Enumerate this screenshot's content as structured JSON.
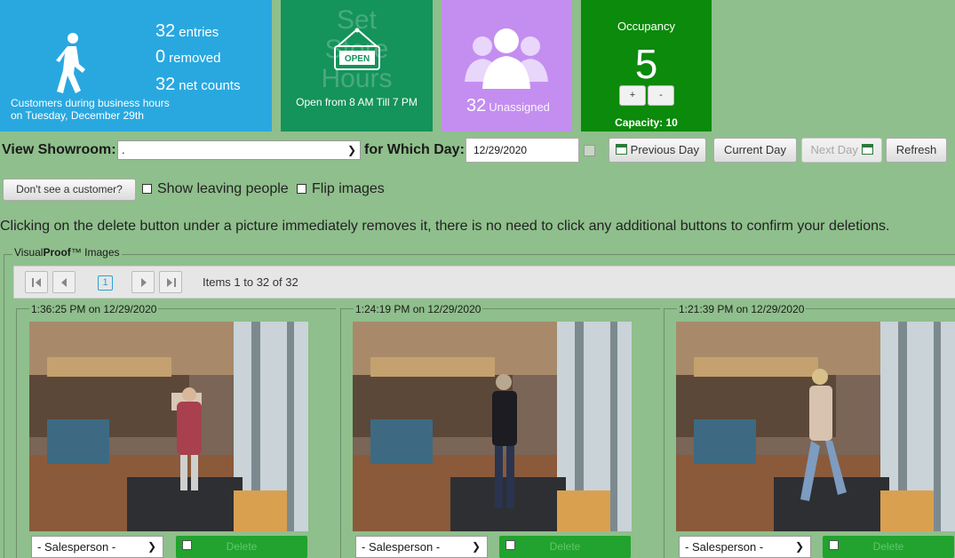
{
  "tiles": {
    "customers": {
      "entries_value": "32",
      "entries_label": "entries",
      "removed_value": "0",
      "removed_label": "removed",
      "net_value": "32",
      "net_label": "net counts",
      "caption_line1": "Customers during business hours",
      "caption_line2": "on Tuesday, December 29th"
    },
    "hours": {
      "ghost_line1": "Set",
      "ghost_line2": "Store",
      "ghost_line3": "Hours",
      "sign_text": "OPEN",
      "caption": "Open from 8 AM Till 7 PM"
    },
    "unassigned": {
      "value": "32",
      "label": "Unassigned"
    },
    "occupancy": {
      "title": "Occupancy",
      "value": "5",
      "plus_label": "+",
      "minus_label": "-",
      "capacity": "Capacity: 10"
    }
  },
  "controls": {
    "showroom_label": "View Showroom:",
    "showroom_value": ".",
    "day_label": "for Which Day:",
    "date_value": "12/29/2020",
    "prev_day": "Previous Day",
    "current_day": "Current Day",
    "next_day": "Next Day",
    "refresh": "Refresh",
    "dont_see": "Don't see a customer?",
    "show_leaving": "Show leaving people",
    "flip_images": "Flip images"
  },
  "notice": "Clicking on the delete button under a picture immediately removes it, there is no need to click any additional buttons to confirm your deletions.",
  "visualproof": {
    "legend_prefix": "Visual",
    "legend_bold": "Proof",
    "legend_suffix": "™ Images",
    "page_number": "1",
    "items_info": "Items 1 to 32 of 32"
  },
  "cards": [
    {
      "timestamp": "1:36:25 PM on 12/29/2020",
      "salesperson": "- Salesperson -",
      "delete_label": "Delete"
    },
    {
      "timestamp": "1:24:19 PM on 12/29/2020",
      "salesperson": "- Salesperson -",
      "delete_label": "Delete"
    },
    {
      "timestamp": "1:21:39 PM on 12/29/2020",
      "salesperson": "- Salesperson -",
      "delete_label": "Delete"
    }
  ],
  "colors": {
    "page_bg": "#8fbf8c",
    "tile_blue": "#29a8e0",
    "tile_green": "#14935a",
    "tile_purple": "#c48ef0",
    "tile_occupancy": "#0b8a0b",
    "delete_green": "#22a22f"
  }
}
